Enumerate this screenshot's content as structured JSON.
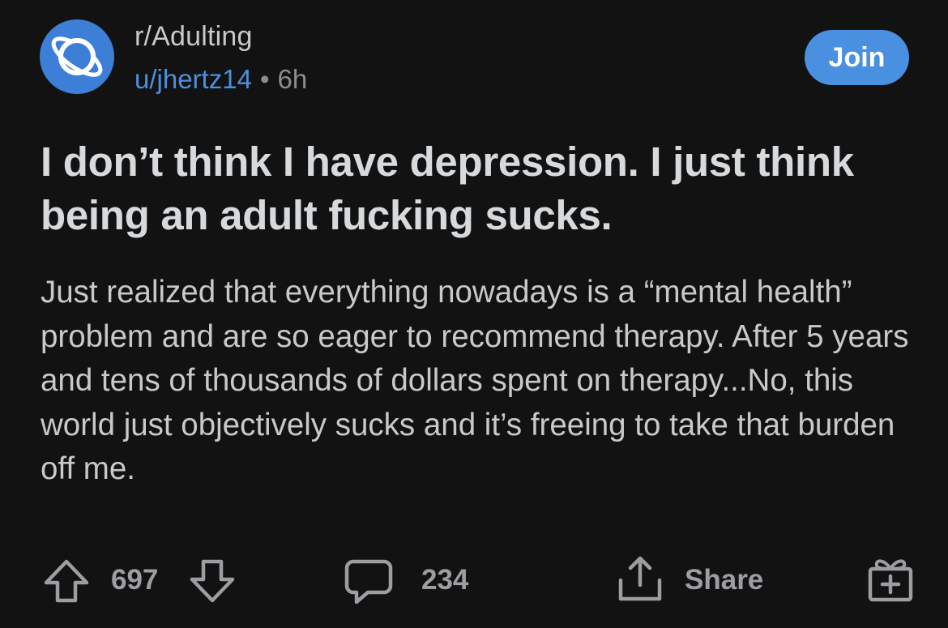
{
  "post": {
    "subreddit": "r/Adulting",
    "author": "u/jhertz14",
    "separator": "•",
    "age": "6h",
    "join_label": "Join",
    "title": "I don’t think I have depression. I just think being an adult fucking sucks.",
    "body": "Just realized that everything nowadays is a “mental health” problem and are so eager to recommend therapy. After 5 years and tens of thousands of dollars spent on therapy...No, this world just objectively sucks and it’s freeing to take that burden off me."
  },
  "actions": {
    "upvote_icon": "arrow-up-outline-icon",
    "score": "697",
    "downvote_icon": "arrow-down-outline-icon",
    "comment_icon": "speech-bubble-icon",
    "comments": "234",
    "share_icon": "share-upload-icon",
    "share_label": "Share",
    "award_icon": "gift-box-icon"
  },
  "colors": {
    "background": "#121213",
    "accent": "#4a90e0",
    "avatar": "#3d7fd6",
    "title_text": "#d7dadc",
    "muted_text": "#8b8d90"
  }
}
